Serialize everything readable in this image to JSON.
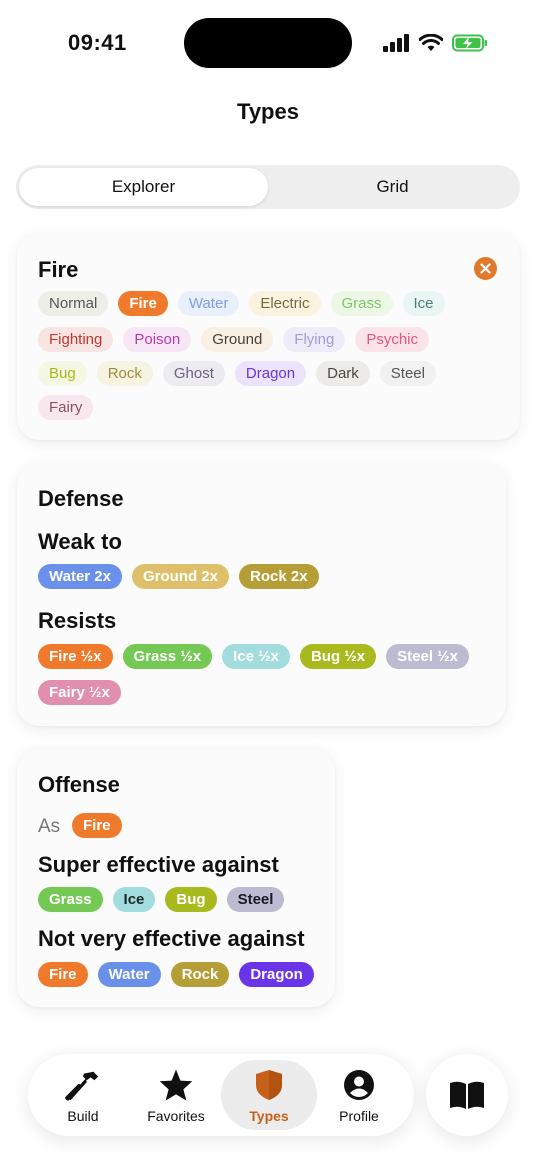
{
  "status": {
    "time": "09:41"
  },
  "title": "Types",
  "segmented": {
    "items": [
      "Explorer",
      "Grid"
    ],
    "selected": "Explorer"
  },
  "selector": {
    "selected_type": "Fire",
    "rows": [
      [
        {
          "label": "Normal",
          "bg": "#eeeee8",
          "fg": "#555"
        },
        {
          "label": "Fire",
          "bg": "#ef7a2c",
          "fg": "#fff",
          "solid": true
        },
        {
          "label": "Water",
          "bg": "#eaf0fb",
          "fg": "#7d9ee8"
        },
        {
          "label": "Electric",
          "bg": "#fbf3e0",
          "fg": "#7a6a40"
        },
        {
          "label": "Grass",
          "bg": "#ecf7e6",
          "fg": "#7cc66a"
        },
        {
          "label": "Ice",
          "bg": "#eaf6f4",
          "fg": "#4f7d78"
        }
      ],
      [
        {
          "label": "Fighting",
          "bg": "#f8e4e2",
          "fg": "#c0392b"
        },
        {
          "label": "Poison",
          "bg": "#f8e5f6",
          "fg": "#b43cab"
        },
        {
          "label": "Ground",
          "bg": "#f8f1e3",
          "fg": "#4a4030"
        },
        {
          "label": "Flying",
          "bg": "#efecfa",
          "fg": "#a69ad9"
        },
        {
          "label": "Psychic",
          "bg": "#fbe3ea",
          "fg": "#e0577c"
        }
      ],
      [
        {
          "label": "Bug",
          "bg": "#f4f7e2",
          "fg": "#a8b820"
        },
        {
          "label": "Rock",
          "bg": "#f6f3e3",
          "fg": "#9e8f3a"
        },
        {
          "label": "Ghost",
          "bg": "#ecebf0",
          "fg": "#6e6185"
        },
        {
          "label": "Dragon",
          "bg": "#ebe3fb",
          "fg": "#6a35d8"
        },
        {
          "label": "Dark",
          "bg": "#ecebe7",
          "fg": "#4e463f"
        },
        {
          "label": "Steel",
          "bg": "#f1f1f1",
          "fg": "#555"
        }
      ],
      [
        {
          "label": "Fairy",
          "bg": "#f8e7ec",
          "fg": "#8a5065"
        }
      ]
    ]
  },
  "defense": {
    "heading": "Defense",
    "weak_heading": "Weak to",
    "weak": [
      {
        "label": "Water 2x",
        "bg": "#6a90ea"
      },
      {
        "label": "Ground 2x",
        "bg": "#dfc06a"
      },
      {
        "label": "Rock 2x",
        "bg": "#b59e35"
      }
    ],
    "resists_heading": "Resists",
    "resists_row1": [
      {
        "label": "Fire ½x",
        "bg": "#ef7a2c"
      },
      {
        "label": "Grass ½x",
        "bg": "#74c954"
      },
      {
        "label": "Ice ½x",
        "bg": "#a2dcdc"
      },
      {
        "label": "Bug ½x",
        "bg": "#a9ba1f"
      },
      {
        "label": "Steel ½x",
        "bg": "#bcbbd2"
      }
    ],
    "resists_row2": [
      {
        "label": "Fairy ½x",
        "bg": "#e08fae"
      }
    ]
  },
  "offense": {
    "heading": "Offense",
    "as_label": "As",
    "as_type": {
      "label": "Fire",
      "bg": "#ef7a2c"
    },
    "super_heading": "Super effective against",
    "super": [
      {
        "label": "Grass",
        "bg": "#74c954",
        "fg": "#fff"
      },
      {
        "label": "Ice",
        "bg": "#a2dcdc",
        "fg": "#1a2a2a"
      },
      {
        "label": "Bug",
        "bg": "#a9ba1f",
        "fg": "#fff"
      },
      {
        "label": "Steel",
        "bg": "#bcbbd2",
        "fg": "#1a1a2a"
      }
    ],
    "notvery_heading": "Not very effective against",
    "notvery": [
      {
        "label": "Fire",
        "bg": "#ef7a2c",
        "fg": "#fff"
      },
      {
        "label": "Water",
        "bg": "#6a90ea",
        "fg": "#fff"
      },
      {
        "label": "Rock",
        "bg": "#b59e35",
        "fg": "#fff"
      },
      {
        "label": "Dragon",
        "bg": "#6a35e8",
        "fg": "#fff"
      }
    ]
  },
  "tabbar": {
    "items": [
      {
        "label": "Build",
        "icon": "hammer-icon"
      },
      {
        "label": "Favorites",
        "icon": "star-icon"
      },
      {
        "label": "Types",
        "icon": "shield-icon",
        "active": true
      },
      {
        "label": "Profile",
        "icon": "person-icon"
      }
    ],
    "extra_button_icon": "book-icon",
    "accent": "#c7611a"
  }
}
